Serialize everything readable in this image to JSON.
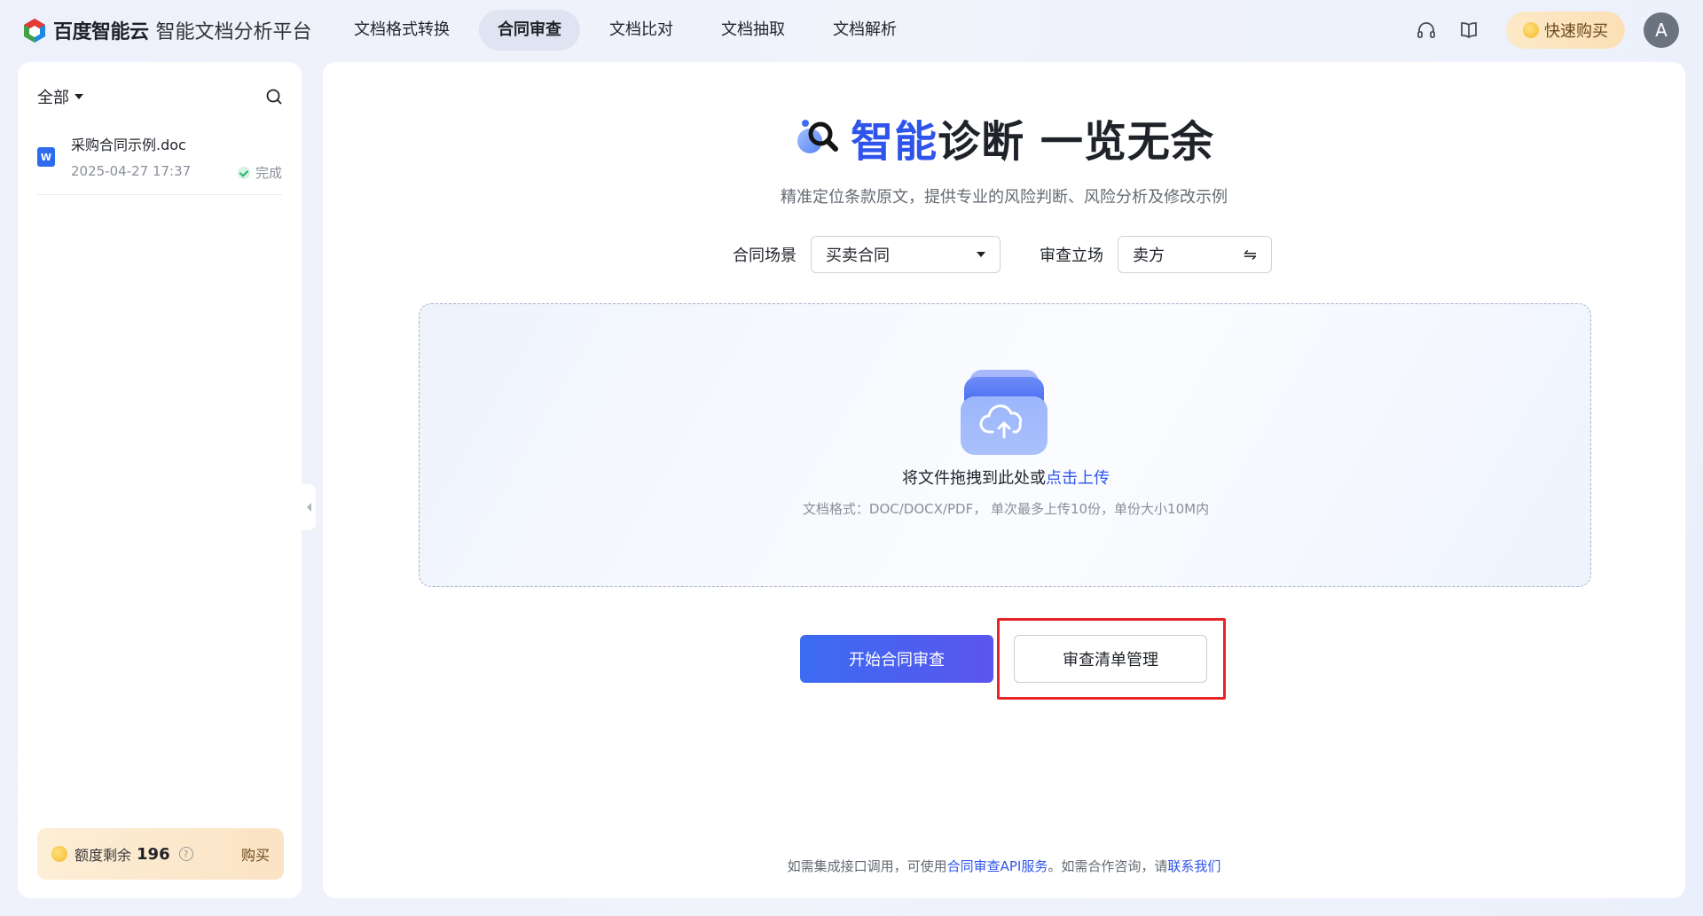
{
  "header": {
    "brand": "百度智能云",
    "product": "智能文档分析平台",
    "nav": [
      {
        "label": "文档格式转换",
        "active": false
      },
      {
        "label": "合同审查",
        "active": true
      },
      {
        "label": "文档比对",
        "active": false
      },
      {
        "label": "文档抽取",
        "active": false
      },
      {
        "label": "文档解析",
        "active": false
      }
    ],
    "buy_label": "快速购买",
    "avatar_letter": "A"
  },
  "sidebar": {
    "filter_label": "全部",
    "files": [
      {
        "name": "采购合同示例.doc",
        "date": "2025-04-27 17:37",
        "status": "完成",
        "type_badge": "W"
      }
    ],
    "quota": {
      "label": "额度剩余",
      "value": "196",
      "help": "?",
      "buy_label": "购买"
    }
  },
  "main": {
    "hero_highlight": "智能",
    "hero_rest": "诊断 一览无余",
    "subtitle": "精准定位条款原文，提供专业的风险判断、风险分析及修改示例",
    "scene_label": "合同场景",
    "scene_value": "买卖合同",
    "position_label": "审查立场",
    "position_value": "卖方",
    "swap_glyph": "⇋",
    "upload": {
      "text": "将文件拖拽到此处或",
      "link": "点击上传",
      "hint": "文档格式：DOC/DOCX/PDF， 单次最多上传10份，单份大小10M内"
    },
    "start_button": "开始合同审查",
    "checklist_button": "审查清单管理",
    "footer": {
      "prefix": "如需集成接口调用，可使用",
      "api_link": "合同审查API服务",
      "middle": "。如需合作咨询，请",
      "contact_link": "联系我们"
    }
  },
  "colors": {
    "accent": "#2f54eb",
    "highlight_box": "#e8242b",
    "status_ok": "#27b26b"
  }
}
